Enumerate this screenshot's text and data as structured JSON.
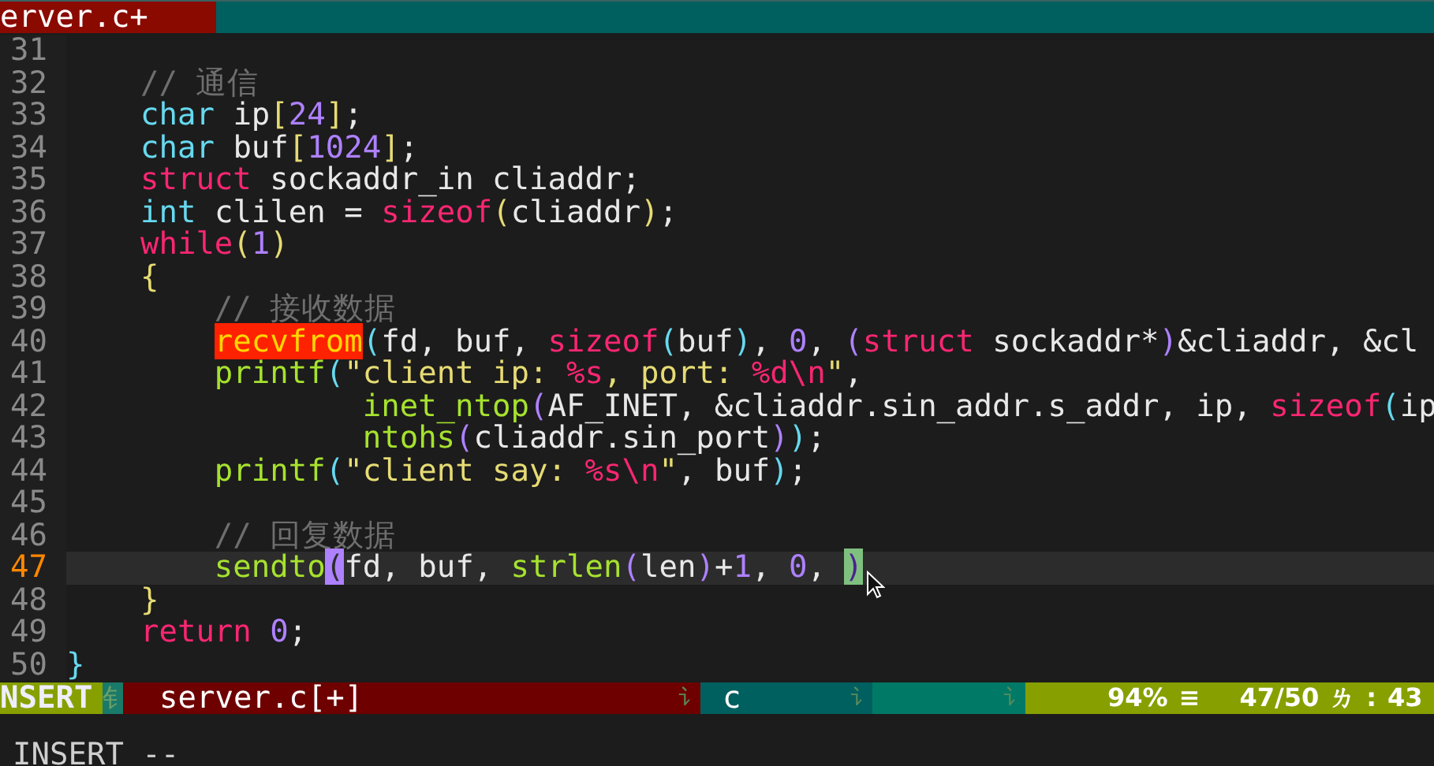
{
  "tabline": {
    "tabs": [
      {
        "label": "erver.c+",
        "selected": true
      }
    ]
  },
  "editor": {
    "lines": [
      {
        "number": "31",
        "current": false
      },
      {
        "number": "32",
        "current": false,
        "tokens": [
          {
            "kind": "comment",
            "text": "    // 通信"
          }
        ]
      },
      {
        "number": "33",
        "current": false,
        "tokens": [
          {
            "kind": "type",
            "text": "    char"
          },
          {
            "kind": "plain",
            "text": " ip"
          },
          {
            "kind": "bracket",
            "text": "["
          },
          {
            "kind": "number",
            "text": "24"
          },
          {
            "kind": "bracket",
            "text": "]"
          },
          {
            "kind": "plain",
            "text": ";"
          }
        ]
      },
      {
        "number": "34",
        "current": false,
        "tokens": [
          {
            "kind": "type",
            "text": "    char"
          },
          {
            "kind": "plain",
            "text": " buf"
          },
          {
            "kind": "bracket",
            "text": "["
          },
          {
            "kind": "number",
            "text": "1024"
          },
          {
            "kind": "bracket",
            "text": "]"
          },
          {
            "kind": "plain",
            "text": ";"
          }
        ]
      },
      {
        "number": "35",
        "current": false,
        "tokens": [
          {
            "kind": "keyword",
            "text": "    struct"
          },
          {
            "kind": "plain",
            "text": " sockaddr_in cliaddr;"
          }
        ]
      },
      {
        "number": "36",
        "current": false,
        "tokens": [
          {
            "kind": "type",
            "text": "    int"
          },
          {
            "kind": "plain",
            "text": " clilen = "
          },
          {
            "kind": "keyword",
            "text": "sizeof"
          },
          {
            "kind": "bracket",
            "text": "("
          },
          {
            "kind": "plain",
            "text": "cliaddr"
          },
          {
            "kind": "bracket",
            "text": ")"
          },
          {
            "kind": "plain",
            "text": ";"
          }
        ]
      },
      {
        "number": "37",
        "current": false,
        "tokens": [
          {
            "kind": "keyword",
            "text": "    while"
          },
          {
            "kind": "bracket",
            "text": "("
          },
          {
            "kind": "number",
            "text": "1"
          },
          {
            "kind": "bracket",
            "text": ")"
          }
        ]
      },
      {
        "number": "38",
        "current": false,
        "tokens": [
          {
            "kind": "bracket",
            "text": "    {"
          }
        ]
      },
      {
        "number": "39",
        "current": false,
        "tokens": [
          {
            "kind": "comment",
            "text": "        // 接收数据"
          }
        ]
      },
      {
        "number": "40",
        "current": false,
        "tokens": [
          {
            "kind": "error",
            "text": "        recvfrom"
          },
          {
            "kind": "bracket2",
            "text": "("
          },
          {
            "kind": "plain",
            "text": "fd, buf, "
          },
          {
            "kind": "keyword",
            "text": "sizeof"
          },
          {
            "kind": "bracket2",
            "text": "("
          },
          {
            "kind": "plain",
            "text": "buf"
          },
          {
            "kind": "bracket2",
            "text": ")"
          },
          {
            "kind": "plain",
            "text": ", "
          },
          {
            "kind": "number",
            "text": "0"
          },
          {
            "kind": "plain",
            "text": ", "
          },
          {
            "kind": "bracket3",
            "text": "("
          },
          {
            "kind": "keyword",
            "text": "struct"
          },
          {
            "kind": "plain",
            "text": " sockaddr*"
          },
          {
            "kind": "bracket3",
            "text": ")"
          },
          {
            "kind": "plain",
            "text": "&cliaddr, &cl"
          }
        ]
      },
      {
        "number": "41",
        "current": false,
        "tokens": [
          {
            "kind": "function",
            "text": "        printf"
          },
          {
            "kind": "bracket2",
            "text": "("
          },
          {
            "kind": "string",
            "text": "\"client ip: "
          },
          {
            "kind": "keyword",
            "text": "%s"
          },
          {
            "kind": "string",
            "text": ", port: "
          },
          {
            "kind": "keyword",
            "text": "%d\\n"
          },
          {
            "kind": "string",
            "text": "\""
          },
          {
            "kind": "plain",
            "text": ","
          }
        ]
      },
      {
        "number": "42",
        "current": false,
        "tokens": [
          {
            "kind": "function",
            "text": "                inet_ntop"
          },
          {
            "kind": "bracket3",
            "text": "("
          },
          {
            "kind": "plain",
            "text": "AF_INET, &cliaddr.sin_addr.s_addr, ip, "
          },
          {
            "kind": "keyword",
            "text": "sizeof"
          },
          {
            "kind": "bracket2",
            "text": "("
          },
          {
            "kind": "plain",
            "text": "ip"
          }
        ]
      },
      {
        "number": "43",
        "current": false,
        "tokens": [
          {
            "kind": "function",
            "text": "                ntohs"
          },
          {
            "kind": "bracket3",
            "text": "("
          },
          {
            "kind": "plain",
            "text": "cliaddr.sin_port"
          },
          {
            "kind": "bracket3",
            "text": ")"
          },
          {
            "kind": "bracket2",
            "text": ")"
          },
          {
            "kind": "plain",
            "text": ";"
          }
        ]
      },
      {
        "number": "44",
        "current": false,
        "tokens": [
          {
            "kind": "function",
            "text": "        printf"
          },
          {
            "kind": "bracket2",
            "text": "("
          },
          {
            "kind": "string",
            "text": "\"client say: "
          },
          {
            "kind": "keyword",
            "text": "%s\\n"
          },
          {
            "kind": "string",
            "text": "\""
          },
          {
            "kind": "plain",
            "text": ", buf"
          },
          {
            "kind": "bracket2",
            "text": ")"
          },
          {
            "kind": "plain",
            "text": ";"
          }
        ]
      },
      {
        "number": "45",
        "current": false
      },
      {
        "number": "46",
        "current": false,
        "tokens": [
          {
            "kind": "comment",
            "text": "        // 回复数据"
          }
        ]
      },
      {
        "number": "47",
        "current": true,
        "tokens": [
          {
            "kind": "function",
            "text": "        sendto"
          },
          {
            "kind": "cursor",
            "text": "("
          },
          {
            "kind": "plain",
            "text": "fd, buf, "
          },
          {
            "kind": "function",
            "text": "strlen"
          },
          {
            "kind": "bracket3",
            "text": "("
          },
          {
            "kind": "plain",
            "text": "len"
          },
          {
            "kind": "bracket3",
            "text": ")"
          },
          {
            "kind": "plain",
            "text": "+"
          },
          {
            "kind": "number",
            "text": "1"
          },
          {
            "kind": "plain",
            "text": ", "
          },
          {
            "kind": "number",
            "text": "0"
          },
          {
            "kind": "plain",
            "text": ", "
          },
          {
            "kind": "match",
            "text": ")"
          }
        ]
      },
      {
        "number": "48",
        "current": false,
        "tokens": [
          {
            "kind": "bracket",
            "text": "    }"
          }
        ]
      },
      {
        "number": "49",
        "current": false,
        "tokens": [
          {
            "kind": "keyword",
            "text": "    return"
          },
          {
            "kind": "number",
            "text": " 0"
          },
          {
            "kind": "plain",
            "text": ";"
          }
        ]
      },
      {
        "number": "50",
        "current": false,
        "tokens": [
          {
            "kind": "bracket2",
            "text": "}"
          }
        ]
      }
    ]
  },
  "status_bar": {
    "segments": [
      {
        "kind": "mode",
        "texts": [
          "NSERT"
        ]
      },
      {
        "kind": "separator",
        "texts": [
          "钅"
        ]
      },
      {
        "kind": "file",
        "texts": [
          "server.c[+]"
        ],
        "tail": "讠"
      },
      {
        "kind": "filetype",
        "texts": [
          "c"
        ],
        "tail": "讠"
      },
      {
        "kind": "encoding",
        "tail": "讠"
      },
      {
        "kind": "position",
        "texts": [
          "94%",
          "≡",
          "47/50",
          "ㄌ",
          ":",
          "43"
        ]
      }
    ]
  },
  "command_line": {
    "text": "INSERT --"
  }
}
